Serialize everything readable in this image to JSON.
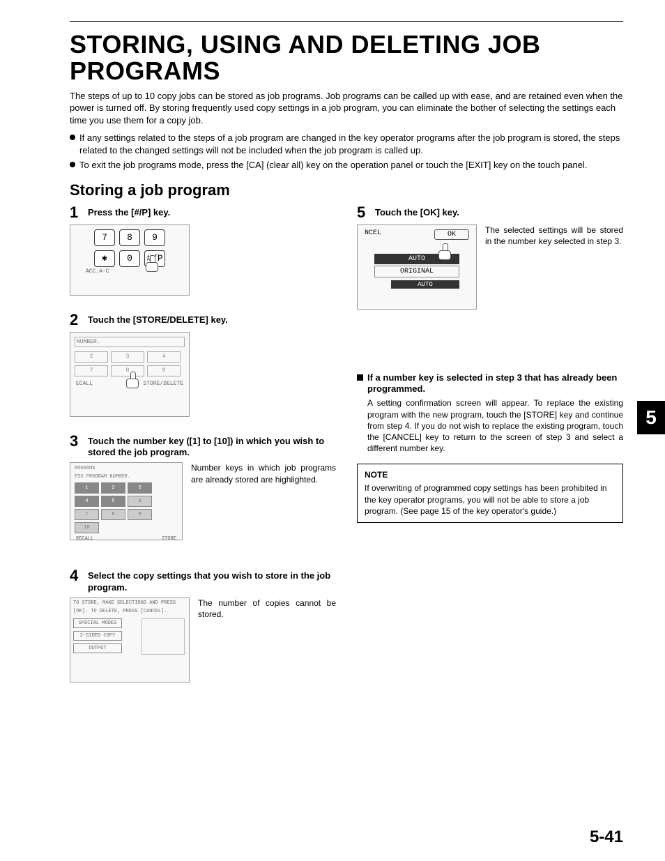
{
  "title": "STORING, USING AND DELETING JOB PROGRAMS",
  "intro": "The steps of up to 10 copy jobs can be stored as job programs. Job programs can be called up with ease, and are retained even when the power is turned off. By storing frequently used copy settings in  a job program, you can eliminate the bother of selecting the settings each time you use them for a copy job.",
  "bullets": [
    "If any settings related to the steps of a job program are changed in the key operator programs after the job program is stored, the steps related to the changed settings will not be included when the job program is called up.",
    "To exit the job programs mode, press the [CA] (clear all) key on the operation panel or touch the [EXIT] key on the touch panel."
  ],
  "section_heading": "Storing a job program",
  "steps": {
    "s1": {
      "num": "1",
      "title": "Press the [#/P] key."
    },
    "s2": {
      "num": "2",
      "title": "Touch the [STORE/DELETE] key."
    },
    "s3": {
      "num": "3",
      "title": "Touch the number key ([1] to [10]) in which you wish to stored the job program.",
      "body": "Number keys in which job programs are already stored are highlighted."
    },
    "s4": {
      "num": "4",
      "title": "Select the copy settings that you wish to store in the job program.",
      "body": "The number of copies cannot be stored."
    },
    "s5": {
      "num": "5",
      "title": "Touch the [OK] key.",
      "body": "The selected settings will be stored in the number key selected in step 3."
    }
  },
  "keypad": {
    "k7": "7",
    "k8": "8",
    "k9": "9",
    "ks": "✱",
    "k0": "0",
    "kp": "#/P",
    "acc": "ACC.#-C"
  },
  "sd_panel": {
    "hdr": "NUMBER.",
    "cells": [
      "2",
      "3",
      "4",
      "7",
      "8",
      "9"
    ],
    "left": "ECALL",
    "right": "STORE/DELETE"
  },
  "prg_panel": {
    "t1": "ROGRAMS",
    "t2": "ESS PROGRAM NUMBER.",
    "cells": [
      "1",
      "2",
      "3",
      "4",
      "5",
      "6",
      "7",
      "8",
      "9",
      "10"
    ],
    "left": "RECALL",
    "right": "STORE"
  },
  "cs_panel": {
    "line1": "TO STORE, MAKE SELECTIONS AND PRESS",
    "line2": "[OK]. TO DELETE, PRESS [CANCEL].",
    "b1": "SPECIAL MODES",
    "b2": "2-SIDED COPY",
    "b3": "OUTPUT"
  },
  "ok_panel": {
    "ncel": "NCEL",
    "ok": "OK",
    "auto": "AUTO",
    "orig": "ORIGINAL",
    "auto2": "AUTO"
  },
  "sub": {
    "heading": "If a number key is selected in step 3 that has already been programmed.",
    "body": "A setting confirmation screen will appear. To replace the existing program with the new program, touch the [STORE] key and continue from step 4. If you do not wish to replace the existing program, touch the [CANCEL] key to return to the screen of step 3 and select a different number key."
  },
  "note": {
    "title": "NOTE",
    "body": "If overwriting of programmed copy settings has been prohibited in the key operator programs, you will not be able to store a job program. (See page 15 of the key operator's guide.)"
  },
  "chapter": "5",
  "page_number": "5-41"
}
